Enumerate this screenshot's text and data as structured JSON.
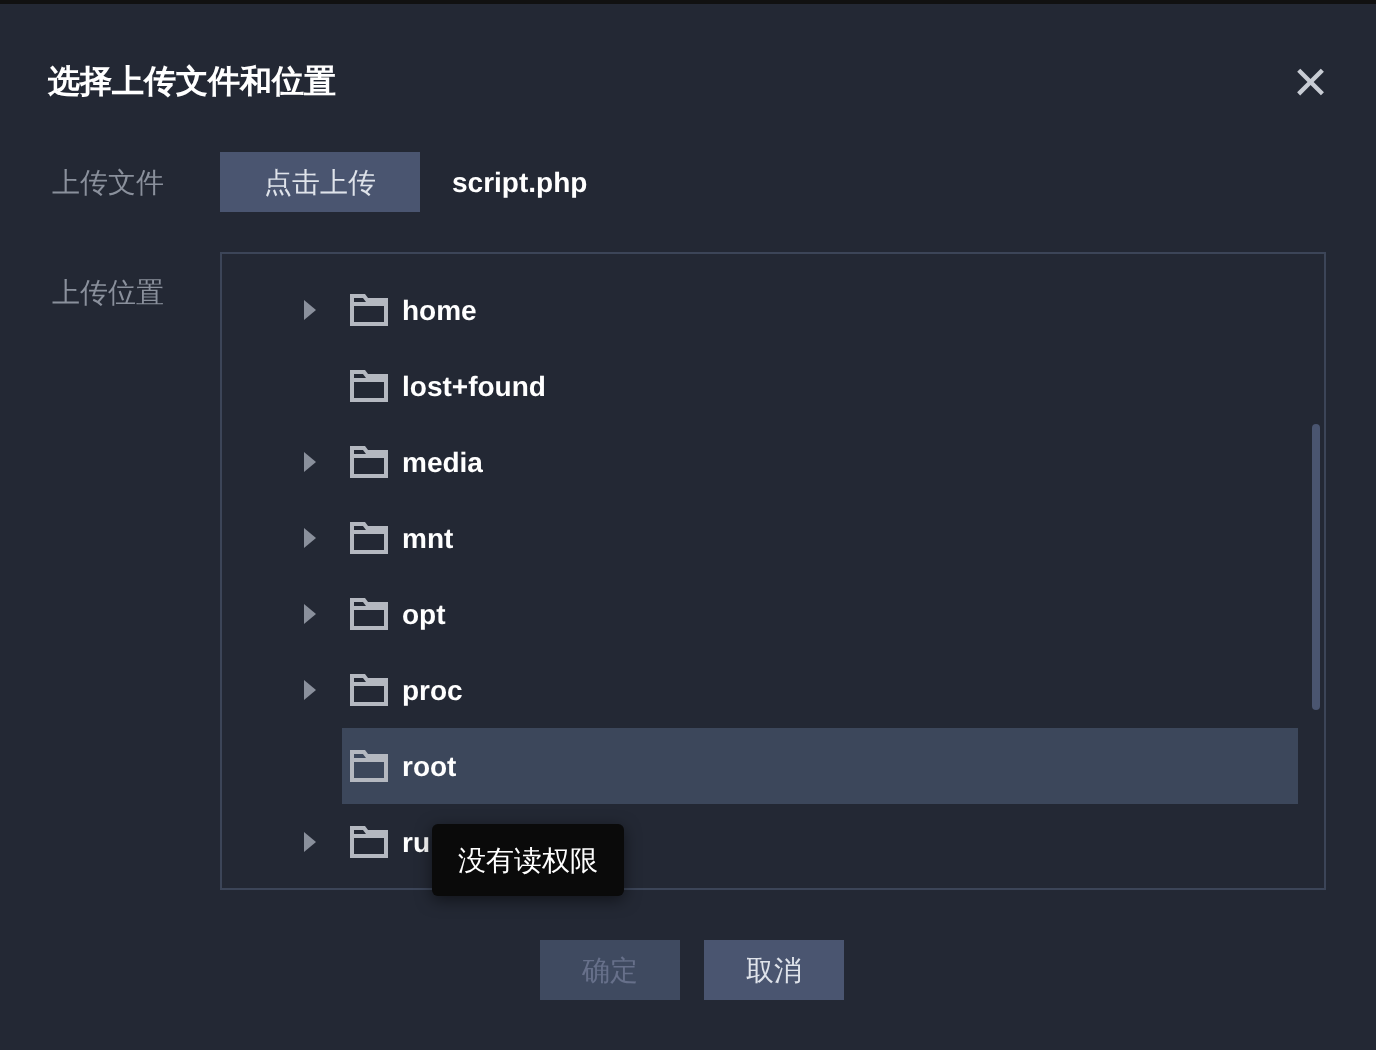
{
  "dialog": {
    "title": "选择上传文件和位置",
    "close": "×"
  },
  "file_row": {
    "label": "上传文件",
    "button": "点击上传",
    "file_name": "script.php"
  },
  "location_row": {
    "label": "上传位置"
  },
  "tree": [
    {
      "name": "home",
      "expandable": true,
      "selected": false
    },
    {
      "name": "lost+found",
      "expandable": false,
      "selected": false
    },
    {
      "name": "media",
      "expandable": true,
      "selected": false
    },
    {
      "name": "mnt",
      "expandable": true,
      "selected": false
    },
    {
      "name": "opt",
      "expandable": true,
      "selected": false
    },
    {
      "name": "proc",
      "expandable": true,
      "selected": false
    },
    {
      "name": "root",
      "expandable": false,
      "selected": true
    },
    {
      "name": "ru",
      "expandable": true,
      "selected": false
    }
  ],
  "tooltip": "没有读权限",
  "buttons": [
    {
      "label": "确定",
      "disabled": true
    },
    {
      "label": "取消",
      "disabled": false
    }
  ]
}
